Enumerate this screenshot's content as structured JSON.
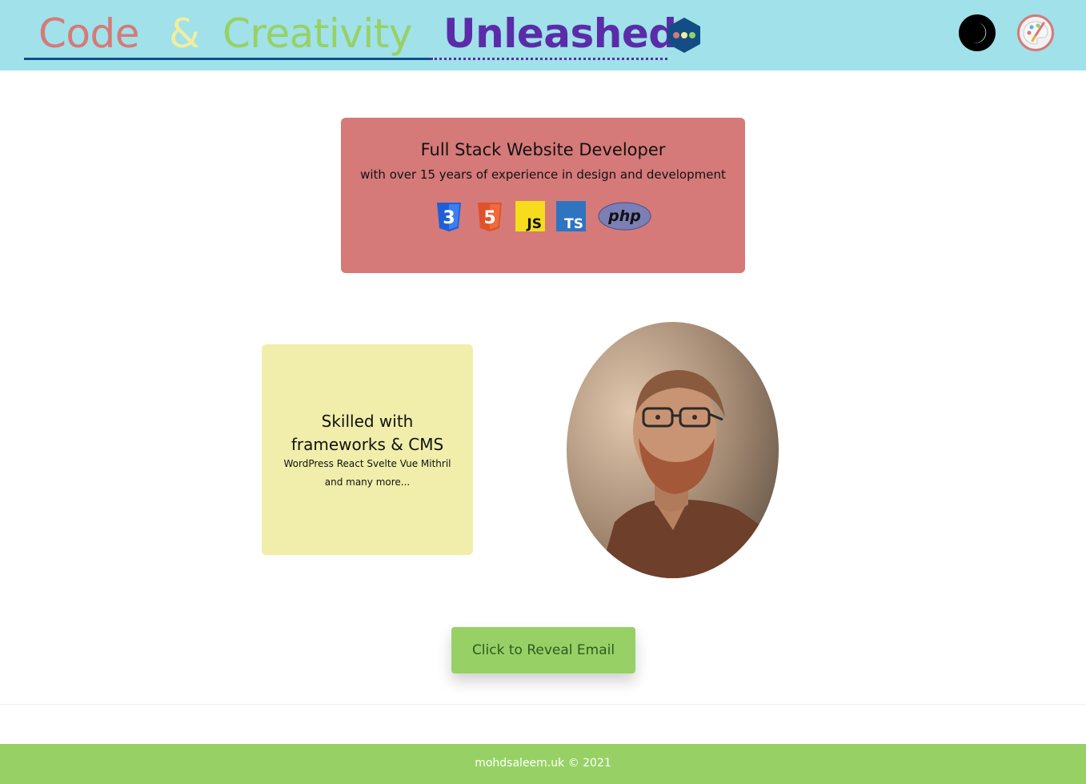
{
  "header": {
    "brand": {
      "word1": "Code",
      "word2": "&",
      "word3": "Creativity",
      "word4": "Unleashed"
    },
    "icons": {
      "logo": "hexagon-dots-icon",
      "theme": "moon-icon",
      "palette": "palette-icon"
    },
    "colors": {
      "bg": "#a0e1ea",
      "code": "#d57a78",
      "amp": "#f0ee9e",
      "creativity": "#97d165",
      "unleashed": "#5a2ca8"
    }
  },
  "intro_card": {
    "title": "Full Stack Website Developer",
    "subtitle": "with over 15 years of experience in design and development",
    "tech_icons": [
      {
        "name": "css3-icon",
        "label": "3"
      },
      {
        "name": "html5-icon",
        "label": "5"
      },
      {
        "name": "javascript-icon",
        "label": "JS"
      },
      {
        "name": "typescript-icon",
        "label": "TS"
      },
      {
        "name": "php-icon",
        "label": "php"
      }
    ],
    "bg": "#d57a78"
  },
  "skills_card": {
    "title_line1": "Skilled with",
    "title_line2": "frameworks & CMS",
    "frameworks": "WordPress React Svelte Vue Mithril",
    "more": "and many more...",
    "bg": "#f0eeaa"
  },
  "profile_photo": {
    "alt": "profile-photo"
  },
  "reveal_button": {
    "label": "Click to Reveal Email",
    "bg": "#97d165"
  },
  "footer": {
    "text": "mohdsaleem.uk © 2021",
    "bg": "#97d165"
  }
}
